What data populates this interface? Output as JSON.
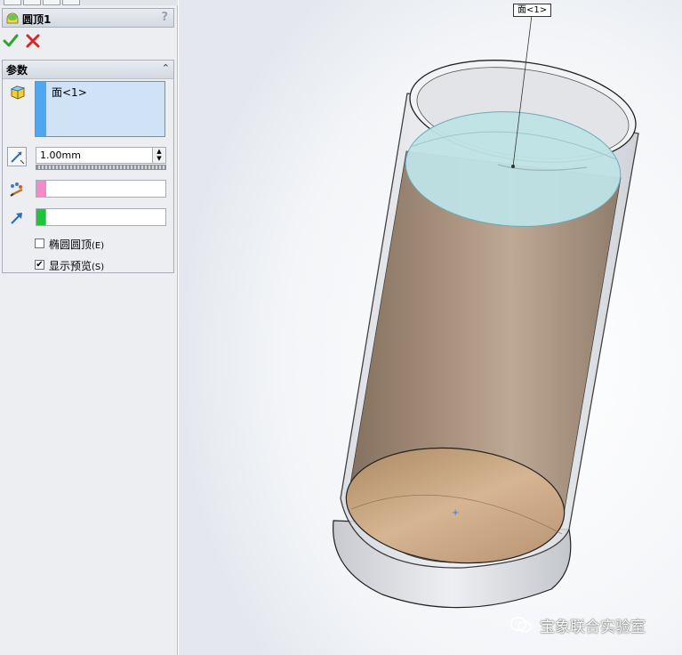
{
  "feature": {
    "title": "圆顶1",
    "help": "?"
  },
  "actions": {
    "ok": "ok-checkmark",
    "cancel": "cancel-x"
  },
  "params": {
    "title": "参数",
    "faces": [
      "面<1>"
    ],
    "distance": "1.00mm",
    "elliptical_label": "椭圆圆顶",
    "elliptical_shortcut": "(E)",
    "elliptical_checked": false,
    "preview_label": "显示预览",
    "preview_shortcut": "(S)",
    "preview_checked": true
  },
  "viewport": {
    "callout": "面<1>"
  },
  "watermark": {
    "text": "宝象联合实验室"
  },
  "colors": {
    "face_selection": "#4fa7f0",
    "constraint_point": "#f38bc7",
    "direction": "#1fc43a",
    "selected_face_fill": "#bfe3e6"
  }
}
